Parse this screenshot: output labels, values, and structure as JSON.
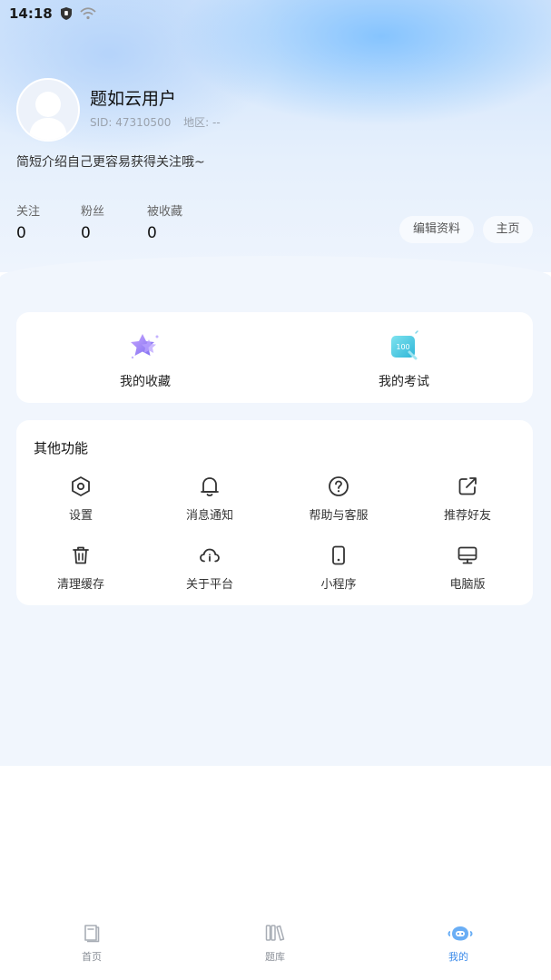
{
  "status_bar": {
    "time": "14:18"
  },
  "profile": {
    "username": "题如云用户",
    "sid": "SID: 47310500",
    "region": "地区: --",
    "bio": "简短介绍自己更容易获得关注哦~",
    "stats": [
      {
        "label": "关注",
        "value": "0"
      },
      {
        "label": "粉丝",
        "value": "0"
      },
      {
        "label": "被收藏",
        "value": "0"
      }
    ],
    "edit_label": "编辑资料",
    "home_label": "主页"
  },
  "quick": {
    "favorites_label": "我的收藏",
    "exams_label": "我的考试",
    "exam_badge": "100"
  },
  "functions": {
    "title": "其他功能",
    "items": [
      {
        "label": "设置",
        "icon": "settings-icon"
      },
      {
        "label": "消息通知",
        "icon": "bell-icon"
      },
      {
        "label": "帮助与客服",
        "icon": "help-icon"
      },
      {
        "label": "推荐好友",
        "icon": "share-icon"
      },
      {
        "label": "清理缓存",
        "icon": "trash-icon"
      },
      {
        "label": "关于平台",
        "icon": "cloud-info-icon"
      },
      {
        "label": "小程序",
        "icon": "phone-icon"
      },
      {
        "label": "电脑版",
        "icon": "desktop-icon"
      }
    ]
  },
  "tabbar": {
    "items": [
      {
        "label": "首页",
        "icon": "home-book-icon"
      },
      {
        "label": "题库",
        "icon": "library-icon"
      },
      {
        "label": "我的",
        "icon": "mine-icon"
      }
    ],
    "active": "我的"
  },
  "colors": {
    "accent": "#3b8bea",
    "page_bg": "#f1f6fd",
    "card_bg": "#ffffff"
  }
}
